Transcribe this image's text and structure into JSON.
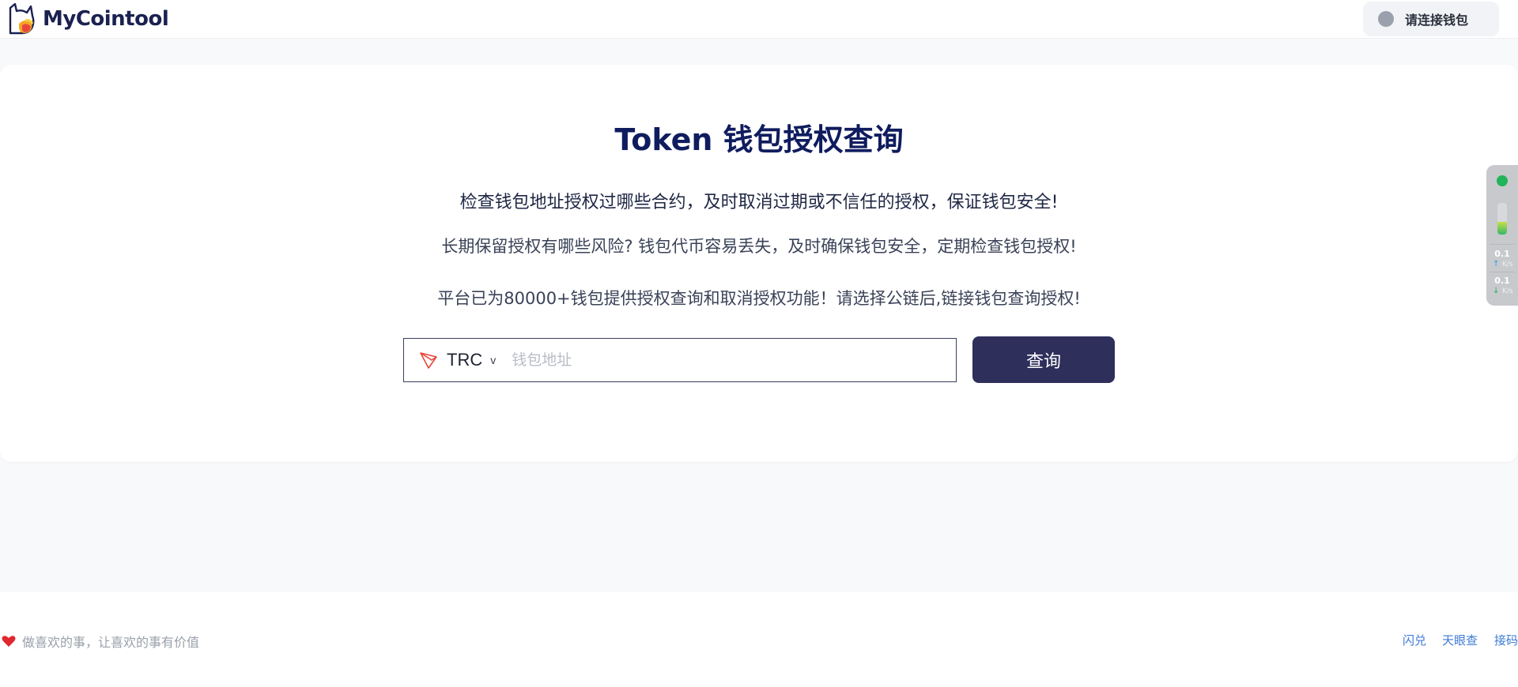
{
  "header": {
    "brand": "MyCointool",
    "wallet_button": "请连接钱包"
  },
  "main": {
    "title": "Token 钱包授权查询",
    "line1": "检查钱包地址授权过哪些合约，及时取消过期或不信任的授权，保证钱包安全!",
    "line2": "长期保留授权有哪些风险? 钱包代币容易丢失，及时确保钱包安全，定期检查钱包授权!",
    "line3": "平台已为80000+钱包提供授权查询和取消授权功能！请选择公链后,链接钱包查询授权!",
    "chain_select": "TRC",
    "chain_chevron": "v",
    "address_placeholder": "钱包地址",
    "query_button": "查询"
  },
  "net_widget": {
    "status_color": "#22b45a",
    "level": 0.4,
    "upload_value": "0.1",
    "upload_unit": "K/s",
    "download_value": "0.1",
    "download_unit": "K/s"
  },
  "footer": {
    "slogan": "做喜欢的事，让喜欢的事有价值",
    "links": [
      "闪兑",
      "天眼查",
      "接码"
    ]
  },
  "colors": {
    "brand_dark": "#1b2150",
    "title": "#0f1c5e",
    "button_bg": "#2e2f5b",
    "link": "#3d7ad6",
    "tron_red": "#e8453c",
    "heart": "#e0282e"
  }
}
